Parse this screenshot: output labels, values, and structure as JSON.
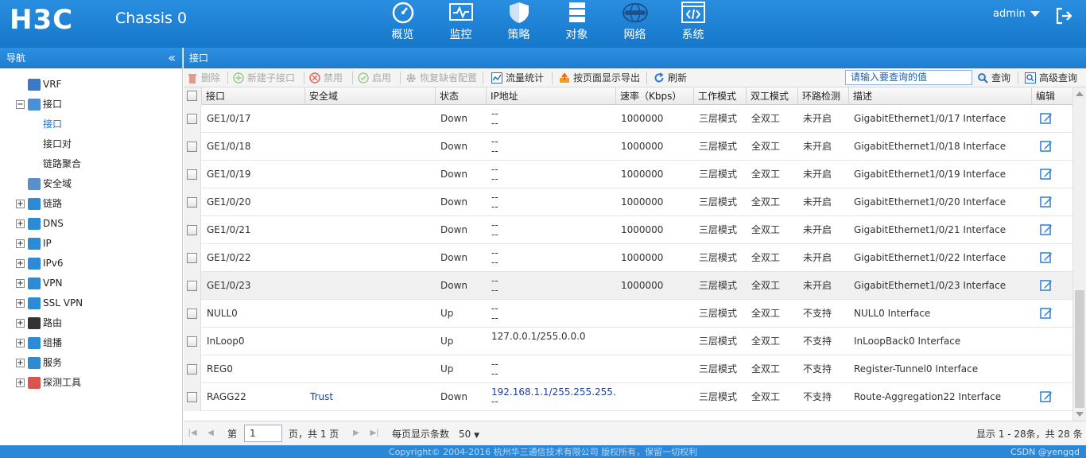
{
  "header": {
    "logo": "H3C",
    "chassis": "Chassis 0",
    "nav": [
      {
        "label": "概览",
        "icon": "gauge-icon"
      },
      {
        "label": "监控",
        "icon": "monitor-icon"
      },
      {
        "label": "策略",
        "icon": "shield-icon"
      },
      {
        "label": "对象",
        "icon": "server-stack-icon"
      },
      {
        "label": "网络",
        "icon": "internet-globe-icon"
      },
      {
        "label": "系统",
        "icon": "code-window-icon"
      }
    ],
    "user": "admin"
  },
  "leftnav": {
    "title": "导航",
    "items": [
      {
        "label": "VRF",
        "icon": "vrf-icon",
        "level": 1,
        "expander": ""
      },
      {
        "label": "接口",
        "icon": "interface-icon",
        "level": 0,
        "expander": "−"
      },
      {
        "label": "接口",
        "icon": "",
        "level": 2,
        "expander": "",
        "active": true
      },
      {
        "label": "接口对",
        "icon": "",
        "level": 2,
        "expander": ""
      },
      {
        "label": "链路聚合",
        "icon": "",
        "level": 2,
        "expander": ""
      },
      {
        "label": "安全域",
        "icon": "security-zone-icon",
        "level": 1,
        "expander": ""
      },
      {
        "label": "链路",
        "icon": "link-icon",
        "level": 0,
        "expander": "+"
      },
      {
        "label": "DNS",
        "icon": "dns-icon",
        "level": 0,
        "expander": "+"
      },
      {
        "label": "IP",
        "icon": "ip-icon",
        "level": 0,
        "expander": "+"
      },
      {
        "label": "IPv6",
        "icon": "ipv6-icon",
        "level": 0,
        "expander": "+"
      },
      {
        "label": "VPN",
        "icon": "vpn-icon",
        "level": 0,
        "expander": "+"
      },
      {
        "label": "SSL VPN",
        "icon": "ssl-vpn-icon",
        "level": 0,
        "expander": "+"
      },
      {
        "label": "路由",
        "icon": "route-icon",
        "level": 0,
        "expander": "+"
      },
      {
        "label": "组播",
        "icon": "multicast-icon",
        "level": 0,
        "expander": "+"
      },
      {
        "label": "服务",
        "icon": "service-icon",
        "level": 0,
        "expander": "+"
      },
      {
        "label": "探测工具",
        "icon": "probe-tool-icon",
        "level": 0,
        "expander": "+"
      }
    ]
  },
  "main": {
    "title": "接口",
    "toolbar": {
      "delete": "删除",
      "new_sub": "新建子接口",
      "disable": "禁用",
      "enable": "启用",
      "restore": "恢复缺省配置",
      "traffic": "流量统计",
      "export": "按页面显示导出",
      "refresh": "刷新",
      "search_placeholder": "请输入要查询的值",
      "query": "查询",
      "advanced": "高级查询"
    },
    "columns": [
      "接口",
      "安全域",
      "状态",
      "IP地址",
      "速率（Kbps）",
      "工作模式",
      "双工模式",
      "环路检测",
      "描述",
      "编辑"
    ],
    "rows": [
      {
        "name": "GE1/0/17",
        "zone": "",
        "status": "Down",
        "ip1": "--",
        "ip2": "--",
        "ipblue": false,
        "speed": "1000000",
        "mode": "三层模式",
        "duplex": "全双工",
        "loop": "未开启",
        "desc": "GigabitEthernet1/0/17 Interface",
        "edit": true
      },
      {
        "name": "GE1/0/18",
        "zone": "",
        "status": "Down",
        "ip1": "--",
        "ip2": "--",
        "ipblue": false,
        "speed": "1000000",
        "mode": "三层模式",
        "duplex": "全双工",
        "loop": "未开启",
        "desc": "GigabitEthernet1/0/18 Interface",
        "edit": true
      },
      {
        "name": "GE1/0/19",
        "zone": "",
        "status": "Down",
        "ip1": "--",
        "ip2": "--",
        "ipblue": true,
        "speed": "1000000",
        "mode": "三层模式",
        "duplex": "全双工",
        "loop": "未开启",
        "desc": "GigabitEthernet1/0/19 Interface",
        "edit": true
      },
      {
        "name": "GE1/0/20",
        "zone": "",
        "status": "Down",
        "ip1": "--",
        "ip2": "--",
        "ipblue": false,
        "speed": "1000000",
        "mode": "三层模式",
        "duplex": "全双工",
        "loop": "未开启",
        "desc": "GigabitEthernet1/0/20 Interface",
        "edit": true
      },
      {
        "name": "GE1/0/21",
        "zone": "",
        "status": "Down",
        "ip1": "--",
        "ip2": "--",
        "ipblue": true,
        "speed": "1000000",
        "mode": "三层模式",
        "duplex": "全双工",
        "loop": "未开启",
        "desc": "GigabitEthernet1/0/21 Interface",
        "edit": true
      },
      {
        "name": "GE1/0/22",
        "zone": "",
        "status": "Down",
        "ip1": "--",
        "ip2": "--",
        "ipblue": false,
        "speed": "1000000",
        "mode": "三层模式",
        "duplex": "全双工",
        "loop": "未开启",
        "desc": "GigabitEthernet1/0/22 Interface",
        "edit": true
      },
      {
        "name": "GE1/0/23",
        "zone": "",
        "status": "Down",
        "ip1": "--",
        "ip2": "--",
        "ipblue": true,
        "speed": "1000000",
        "mode": "三层模式",
        "duplex": "全双工",
        "loop": "未开启",
        "desc": "GigabitEthernet1/0/23 Interface",
        "edit": true,
        "highlight": true
      },
      {
        "name": "NULL0",
        "zone": "",
        "status": "Up",
        "ip1": "--",
        "ip2": "--",
        "ipblue": false,
        "speed": "",
        "mode": "三层模式",
        "duplex": "全双工",
        "loop": "不支持",
        "desc": "NULL0 Interface",
        "edit": true
      },
      {
        "name": "InLoop0",
        "zone": "",
        "status": "Up",
        "ip1": "127.0.0.1/255.0.0.0",
        "ip2": "",
        "ipblue": false,
        "speed": "",
        "mode": "三层模式",
        "duplex": "全双工",
        "loop": "不支持",
        "desc": "InLoopBack0 Interface",
        "edit": false
      },
      {
        "name": "REG0",
        "zone": "",
        "status": "Up",
        "ip1": "--",
        "ip2": "--",
        "ipblue": false,
        "speed": "",
        "mode": "三层模式",
        "duplex": "全双工",
        "loop": "不支持",
        "desc": "Register-Tunnel0 Interface",
        "edit": false
      },
      {
        "name": "RAGG22",
        "zone": "Trust",
        "status": "Down",
        "ip1": "192.168.1.1/255.255.255.0",
        "ip2": "--",
        "ipblue": true,
        "speed": "",
        "mode": "三层模式",
        "duplex": "全双工",
        "loop": "不支持",
        "desc": "Route-Aggregation22 Interface",
        "edit": true
      }
    ],
    "pager": {
      "page_label": "第",
      "page_value": "1",
      "page_total": "页，共 1 页",
      "per_page_label": "每页显示条数",
      "per_page_value": "50",
      "summary": "显示 1 - 28条，共 28 条"
    }
  },
  "footer": {
    "copyright": "Copyright© 2004-2016 杭州华三通信技术有限公司 版权所有，保留一切权利",
    "watermark": "CSDN @yengqd"
  },
  "colors": {
    "header_blue": "#1a7fd4",
    "link_blue": "#1a3fa0",
    "active_blue": "#1a73c9"
  }
}
